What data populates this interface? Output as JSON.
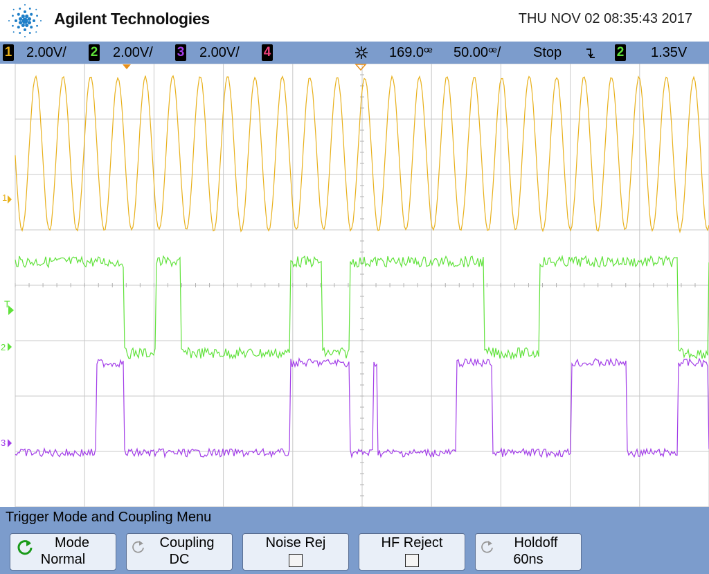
{
  "header": {
    "brand": "Agilent Technologies",
    "datetime": "THU NOV 02 08:35:43 2017"
  },
  "channels": [
    {
      "id": "1",
      "scale": "2.00V/",
      "color": "#e8b01a"
    },
    {
      "id": "2",
      "scale": "2.00V/",
      "color": "#5fe23a"
    },
    {
      "id": "3",
      "scale": "2.00V/",
      "color": "#a23de8"
    },
    {
      "id": "4",
      "scale": "",
      "color": "#e8407a"
    }
  ],
  "timebase": {
    "delay": "169.0ꟹ",
    "scale": "50.00ꟹ/",
    "run_state": "Stop",
    "trigger_source": "2",
    "trigger_level": "1.35V"
  },
  "markers": {
    "ch1": "1",
    "trig": "T",
    "ch2": "2",
    "ch3": "3"
  },
  "menu": {
    "title": "Trigger Mode and Coupling Menu",
    "softkeys": [
      {
        "label": "Mode",
        "value": "Normal"
      },
      {
        "label": "Coupling",
        "value": "DC"
      },
      {
        "label": "Noise Rej",
        "value": ""
      },
      {
        "label": "HF Reject",
        "value": ""
      },
      {
        "label": "Holdoff",
        "value": "60ns"
      }
    ]
  }
}
